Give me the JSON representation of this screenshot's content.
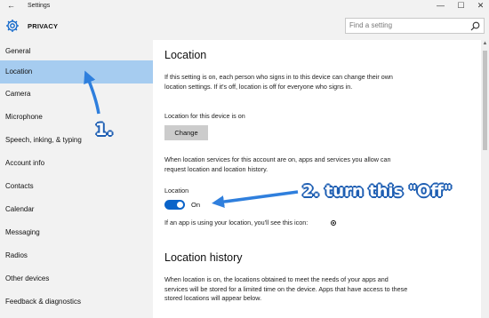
{
  "window": {
    "title": "Settings",
    "back_glyph": "←",
    "minimize_glyph": "—",
    "maximize_glyph": "☐",
    "close_glyph": "✕"
  },
  "header": {
    "section": "PRIVACY",
    "icon": "gear-icon",
    "search_placeholder": "Find a setting",
    "search_icon": "search-icon"
  },
  "sidebar": {
    "selected": "Location",
    "items": [
      {
        "label": "General"
      },
      {
        "label": "Location"
      },
      {
        "label": "Camera"
      },
      {
        "label": "Microphone"
      },
      {
        "label": "Speech, inking, & typing"
      },
      {
        "label": "Account info"
      },
      {
        "label": "Contacts"
      },
      {
        "label": "Calendar"
      },
      {
        "label": "Messaging"
      },
      {
        "label": "Radios"
      },
      {
        "label": "Other devices"
      },
      {
        "label": "Feedback & diagnostics"
      }
    ]
  },
  "main": {
    "title": "Location",
    "intro": "If this setting is on, each person who signs in to this device can change their own location settings. If it's off, location is off for everyone who signs in.",
    "device_status": "Location for this device is on",
    "change_button": "Change",
    "services_text": "When location services for this account are on, apps and services you allow can request location and location history.",
    "toggle_title": "Location",
    "toggle_state": "On",
    "toggle_on": true,
    "icon_note": "If an app is using your location, you'll see this icon:",
    "history_title": "Location history",
    "history_text": "When location is on, the locations obtained to meet the needs of your apps and services will be stored for a limited time on the device. Apps that have access to these stored locations will appear below."
  },
  "annotations": {
    "step1": "1.",
    "step2": "2. turn this \"Off\""
  },
  "colors": {
    "accent": "#0a63c9",
    "selection": "#a6ccf0",
    "annotation": "#1f5fb3"
  }
}
